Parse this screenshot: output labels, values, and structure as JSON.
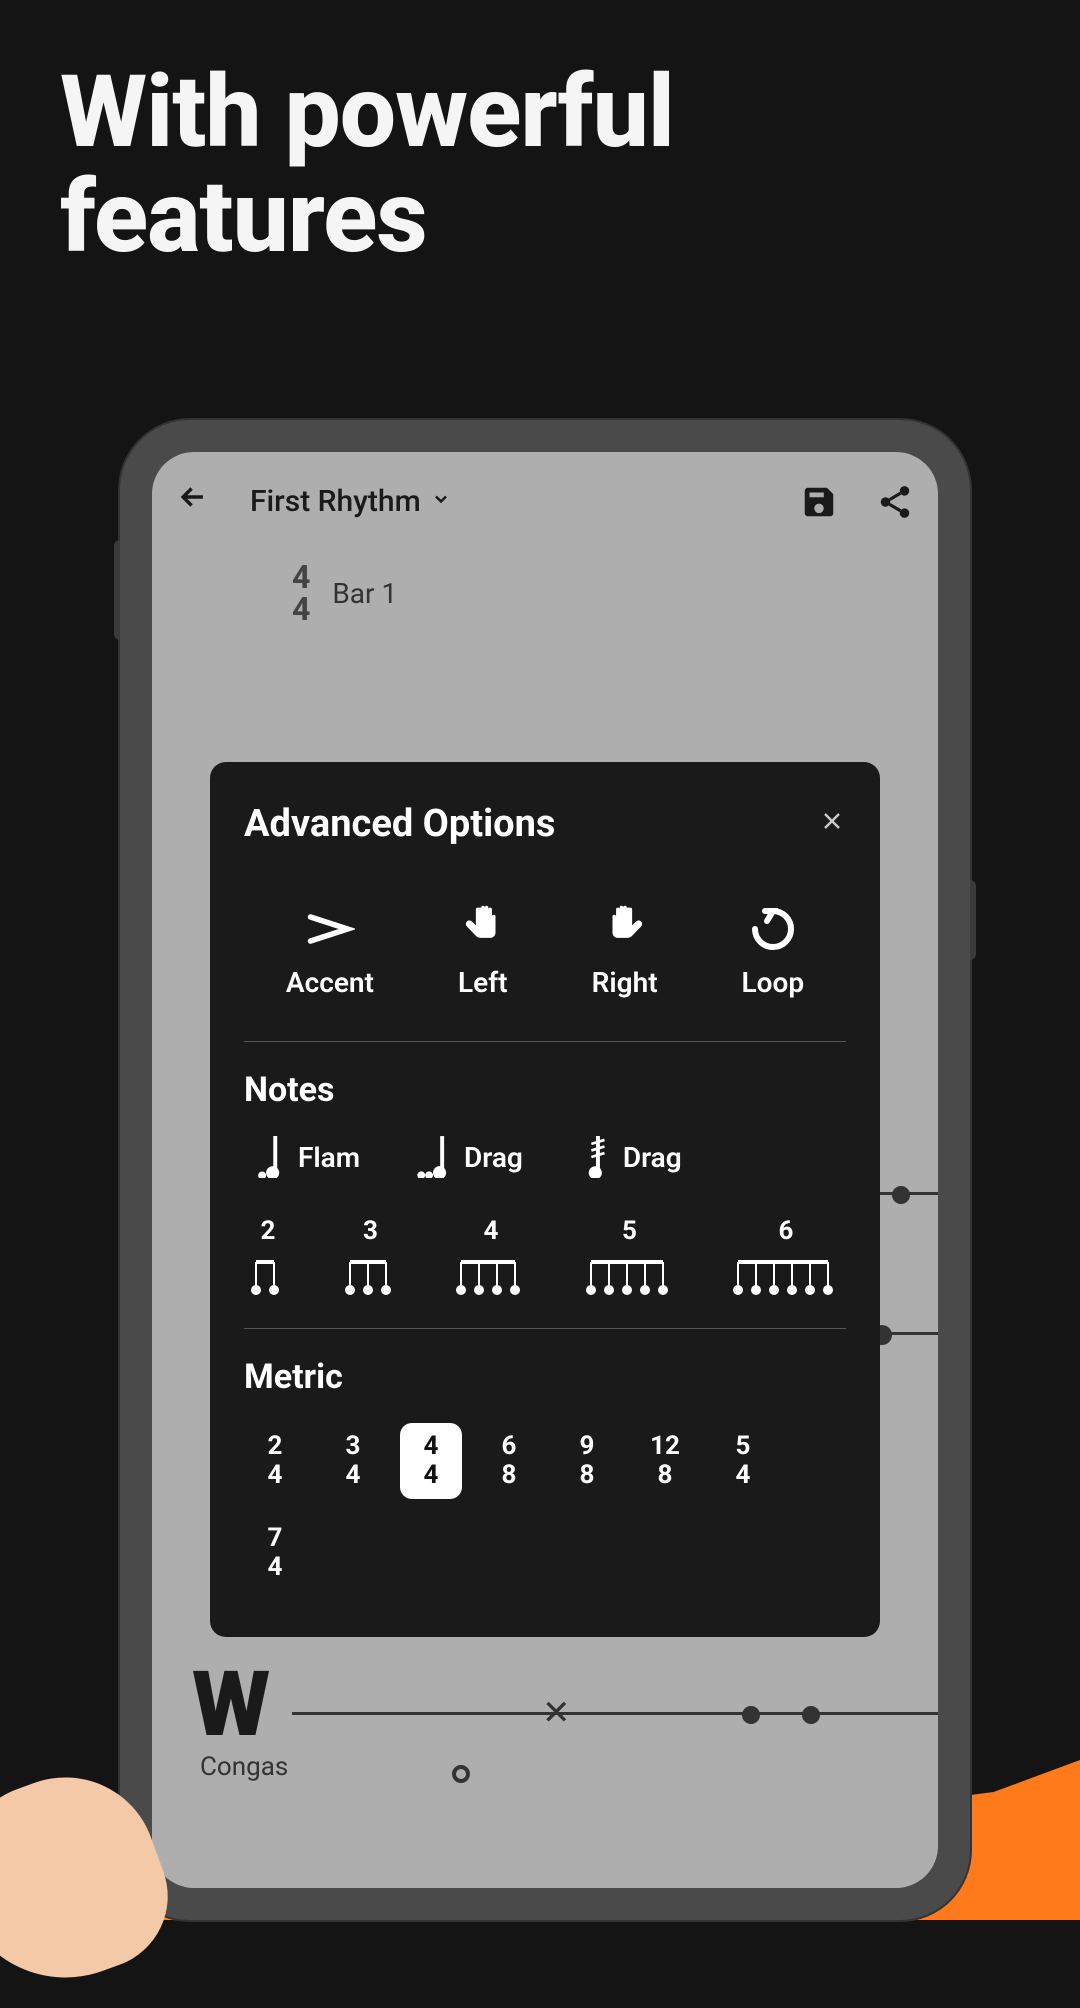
{
  "hero": {
    "line1": "With powerful",
    "line2": "features"
  },
  "app": {
    "title": "First Rhythm",
    "time_sig_top": "4",
    "time_sig_bottom": "4",
    "bar_label": "Bar 1",
    "track_label": "Congas"
  },
  "dialog": {
    "title": "Advanced Options",
    "quick": [
      {
        "key": "accent",
        "label": "Accent"
      },
      {
        "key": "left",
        "label": "Left"
      },
      {
        "key": "right",
        "label": "Right"
      },
      {
        "key": "loop",
        "label": "Loop"
      }
    ],
    "notes_heading": "Notes",
    "note_ornaments": [
      {
        "key": "flam",
        "label": "Flam"
      },
      {
        "key": "drag1",
        "label": "Drag"
      },
      {
        "key": "drag2",
        "label": "Drag"
      }
    ],
    "tuplets": [
      "2",
      "3",
      "4",
      "5",
      "6"
    ],
    "metric_heading": "Metric",
    "metrics": [
      {
        "top": "2",
        "bot": "4",
        "selected": false
      },
      {
        "top": "3",
        "bot": "4",
        "selected": false
      },
      {
        "top": "4",
        "bot": "4",
        "selected": true
      },
      {
        "top": "6",
        "bot": "8",
        "selected": false
      },
      {
        "top": "9",
        "bot": "8",
        "selected": false
      },
      {
        "top": "12",
        "bot": "8",
        "selected": false
      },
      {
        "top": "5",
        "bot": "4",
        "selected": false
      },
      {
        "top": "7",
        "bot": "4",
        "selected": false
      }
    ]
  }
}
